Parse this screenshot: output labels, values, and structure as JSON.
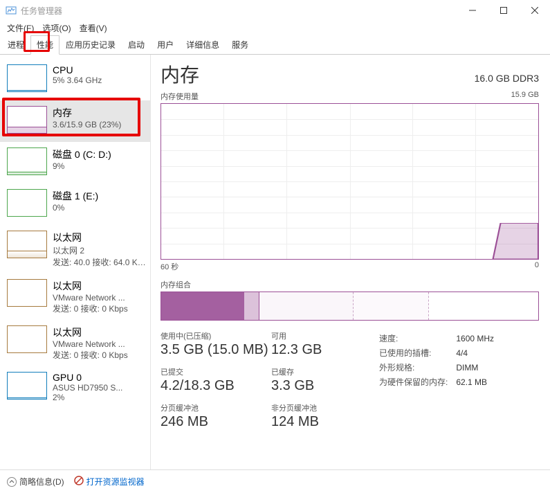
{
  "window": {
    "title": "任务管理器",
    "menus": [
      "文件(F)",
      "选项(O)",
      "查看(V)"
    ]
  },
  "tabs": [
    "进程",
    "性能",
    "应用历史记录",
    "启动",
    "用户",
    "详细信息",
    "服务"
  ],
  "active_tab_index": 1,
  "sidebar": [
    {
      "name": "CPU",
      "sub": "5% 3.64 GHz"
    },
    {
      "name": "内存",
      "sub": "3.6/15.9 GB (23%)"
    },
    {
      "name": "磁盘 0 (C: D:)",
      "sub": "9%"
    },
    {
      "name": "磁盘 1 (E:)",
      "sub": "0%"
    },
    {
      "name": "以太网",
      "sub": "以太网 2",
      "sub2": "发送: 40.0 接收: 64.0 Kbps"
    },
    {
      "name": "以太网",
      "sub": "VMware Network ...",
      "sub2": "发送: 0 接收: 0 Kbps"
    },
    {
      "name": "以太网",
      "sub": "VMware Network ...",
      "sub2": "发送: 0 接收: 0 Kbps"
    },
    {
      "name": "GPU 0",
      "sub": "ASUS HD7950 S...",
      "sub2": "2%"
    }
  ],
  "selected_sidebar_index": 1,
  "content": {
    "title": "内存",
    "capacity": "16.0 GB DDR3",
    "usage_label": "内存使用量",
    "usage_max": "15.9 GB",
    "axis_left": "60 秒",
    "axis_right": "0",
    "composition_label": "内存组合",
    "stats_left": [
      {
        "lbl": "使用中(已压缩)",
        "val": "3.5 GB (15.0 MB)"
      },
      {
        "lbl": "可用",
        "val": "12.3 GB"
      },
      {
        "lbl": "已提交",
        "val": "4.2/18.3 GB"
      },
      {
        "lbl": "已缓存",
        "val": "3.3 GB"
      },
      {
        "lbl": "分页缓冲池",
        "val": "246 MB"
      },
      {
        "lbl": "非分页缓冲池",
        "val": "124 MB"
      }
    ],
    "stats_right": [
      {
        "k": "速度:",
        "v": "1600 MHz"
      },
      {
        "k": "已使用的插槽:",
        "v": "4/4"
      },
      {
        "k": "外形规格:",
        "v": "DIMM"
      },
      {
        "k": "为硬件保留的内存:",
        "v": "62.1 MB"
      }
    ]
  },
  "statusbar": {
    "brief": "简略信息(D)",
    "monitor": "打开资源监视器"
  },
  "chart_data": {
    "type": "area",
    "title": "内存使用量",
    "ylabel": "GB",
    "ylim": [
      0,
      15.9
    ],
    "x_range_seconds": 60,
    "series": [
      {
        "name": "内存使用量 (GB)",
        "values": [
          3.6,
          3.6,
          3.6,
          3.6,
          3.6,
          3.6,
          3.6,
          3.6,
          3.6,
          3.6,
          3.6,
          3.6
        ]
      }
    ]
  }
}
